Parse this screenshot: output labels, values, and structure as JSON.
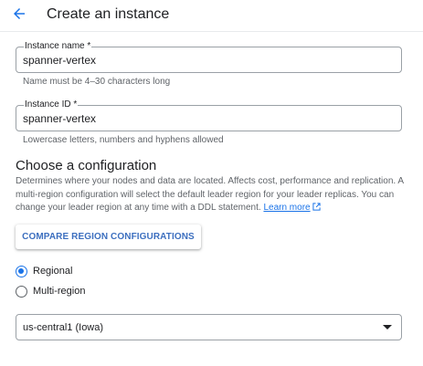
{
  "header": {
    "title": "Create an instance",
    "back_icon": "arrow-back-icon",
    "accent": "#1a73e8"
  },
  "instance_name": {
    "label": "Instance name *",
    "value": "spanner-vertex",
    "helper": "Name must be 4–30 characters long"
  },
  "instance_id": {
    "label": "Instance ID *",
    "value": "spanner-vertex",
    "helper": "Lowercase letters, numbers and hyphens allowed"
  },
  "configuration": {
    "title": "Choose a configuration",
    "description": "Determines where your nodes and data are located. Affects cost, performance and replication. A multi-region configuration will select the default leader region for your leader replicas. You can change your leader region at any time with a DDL statement.",
    "learn_more": "Learn more",
    "external_icon": "open-in-new-icon",
    "compare_button": "COMPARE REGION CONFIGURATIONS",
    "options": [
      {
        "label": "Regional",
        "selected": true
      },
      {
        "label": "Multi-region",
        "selected": false
      }
    ],
    "region_select": {
      "value": "us-central1 (Iowa)",
      "caret_icon": "dropdown-caret-icon"
    }
  }
}
